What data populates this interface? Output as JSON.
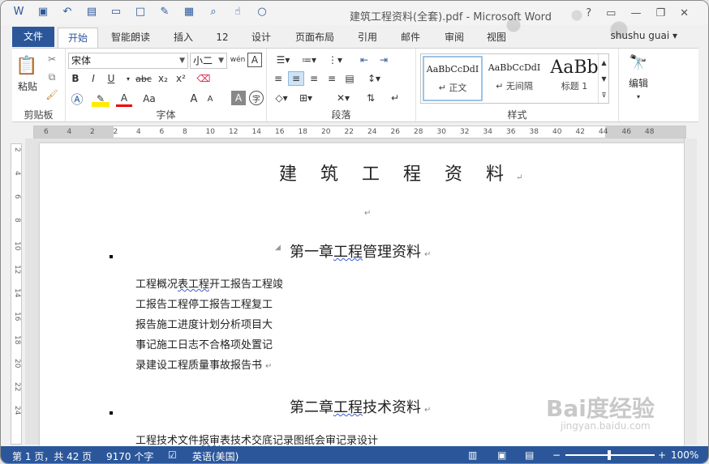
{
  "window": {
    "title": "建筑工程资料(全套).pdf - Microsoft Word",
    "user": "shushu guai"
  },
  "tabs": [
    "文件",
    "开始",
    "智能朗读",
    "插入",
    "12",
    "设计",
    "页面布局",
    "引用",
    "邮件",
    "审阅",
    "视图"
  ],
  "ribbon": {
    "clipboard": {
      "paste_label": "粘贴",
      "group_label": "剪贴板"
    },
    "font": {
      "font_name": "宋体",
      "font_size": "小二",
      "phonetic_label": "wén",
      "group_label": "字体",
      "bold": "B",
      "italic": "I",
      "underline": "U",
      "strike": "abc",
      "sub": "x₂",
      "sup": "x²",
      "case": "Aa",
      "grow": "A",
      "shrink": "A",
      "clear": "A",
      "char_circle": "字"
    },
    "paragraph": {
      "group_label": "段落"
    },
    "styles": {
      "group_label": "样式",
      "items": [
        {
          "sample": "AaBbCcDdI",
          "name": "↵ 正文"
        },
        {
          "sample": "AaBbCcDdI",
          "name": "↵ 无间隔"
        },
        {
          "sample": "AaBb",
          "name": "标题 1"
        }
      ]
    },
    "editing": {
      "label": "编辑"
    }
  },
  "ruler": {
    "ticks": [
      "6",
      "4",
      "2",
      "2",
      "4",
      "6",
      "8",
      "10",
      "12",
      "14",
      "16",
      "18",
      "20",
      "22",
      "24",
      "26",
      "28",
      "30",
      "32",
      "34",
      "36",
      "38",
      "40",
      "42",
      "44",
      "46",
      "48"
    ],
    "vticks": [
      "2",
      "4",
      "6",
      "8",
      "10",
      "12",
      "14",
      "16",
      "18",
      "20",
      "22",
      "24"
    ]
  },
  "document": {
    "title": "建 筑 工 程 资 料",
    "chapter1": {
      "heading_prefix": "第一章",
      "heading_wavy": "工程",
      "heading_suffix": "管理资料"
    },
    "lines1": [
      {
        "pre": "工程概况",
        "wavy": "表工程",
        "post": "开工报告工程竣"
      },
      {
        "pre": "工报告工程停工报告工程复工",
        "wavy": "",
        "post": ""
      },
      {
        "pre": "报告施工进度计划分析项目大",
        "wavy": "",
        "post": ""
      },
      {
        "pre": "事记施工日志不合格项处置记",
        "wavy": "",
        "post": ""
      },
      {
        "pre": "录建设工程质量事故报告书",
        "wavy": "",
        "post": ""
      }
    ],
    "chapter2": {
      "heading_prefix": "第二章",
      "heading_wavy": "工程",
      "heading_suffix": "技术资料"
    },
    "line2": {
      "pre": "工程技术文件",
      "wavy": "报审",
      "post": "表技术交底记录图纸会审记录设计"
    }
  },
  "status": {
    "page": "第 1 页，共 42 页",
    "words": "9170 个字",
    "lang": "英语(美国)",
    "zoom": "100%"
  },
  "watermark": {
    "main": "Bai度经验",
    "sub": "jingyan.baidu.com"
  }
}
